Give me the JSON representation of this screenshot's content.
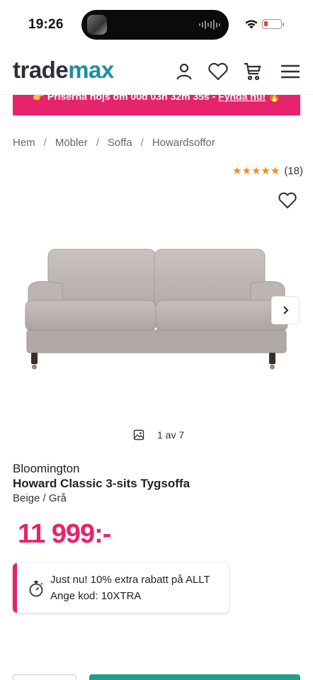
{
  "status_bar": {
    "time": "19:26",
    "icons": [
      "wifi-icon",
      "battery-icon"
    ],
    "battery_color": "#ff3b30"
  },
  "header": {
    "logo_part1": "trade",
    "logo_part2": "max",
    "logo_colors": {
      "primary": "#2d3137",
      "accent": "#1e8fa0"
    },
    "icons": [
      "user-icon",
      "heart-icon",
      "cart-icon",
      "menu-icon"
    ]
  },
  "promo": {
    "text": "👉 Priserna höjs om 00d 03h 32m 35s - ",
    "link": "Fynda nu!",
    "trail": " 🔥",
    "color": "#e6236c"
  },
  "breadcrumb": {
    "items": [
      "Hem",
      "Möbler",
      "Soffa",
      "Howardsoffor"
    ],
    "separator": "/"
  },
  "rating": {
    "stars": "★★★★★",
    "count": "(18)",
    "value": 5,
    "star_color": "#f08a24"
  },
  "gallery": {
    "current": "1 av 7"
  },
  "product": {
    "brand": "Bloomington",
    "title": "Howard Classic 3-sits Tygsoffa",
    "variant": "Beige / Grå",
    "price": "11 999:-",
    "price_color": "#e6236c"
  },
  "coupon": {
    "line1": "Just nu! 10% extra rabatt på ALLT",
    "line2": "Ange kod: 10XTRA",
    "icon": "stopwatch-icon"
  },
  "cta": {
    "color": "#1f9e8a"
  }
}
